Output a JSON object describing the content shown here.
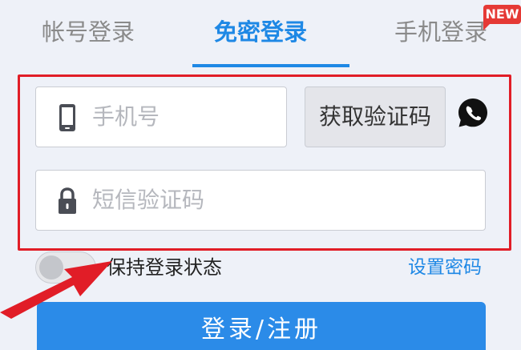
{
  "tabs": {
    "account_login": "帐号登录",
    "passwordless_login": "免密登录",
    "phone_login": "手机登录",
    "new_badge": "NEW"
  },
  "form": {
    "phone_placeholder": "手机号",
    "get_code_label": "获取验证码",
    "sms_code_placeholder": "短信验证码"
  },
  "options": {
    "keep_logged_in_label": "保持登录状态",
    "set_password_link": "设置密码"
  },
  "actions": {
    "login_register_label": "登录/注册"
  },
  "colors": {
    "accent": "#1e88e5",
    "button": "#2b8be8",
    "highlight": "#e11d27",
    "background": "#eef1f8"
  },
  "icons": {
    "phone_field": "mobile-phone-icon",
    "sms_field": "padlock-icon",
    "whatsapp": "whatsapp-icon"
  }
}
